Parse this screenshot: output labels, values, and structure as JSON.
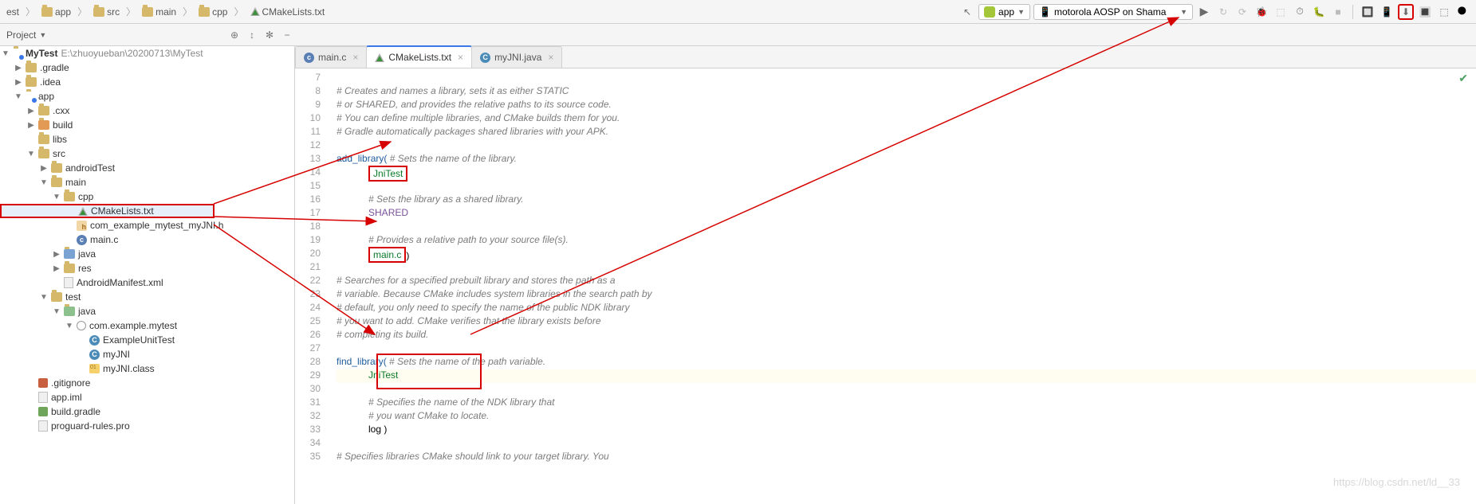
{
  "breadcrumb": {
    "items": [
      {
        "label": "est"
      },
      {
        "label": "app"
      },
      {
        "label": "src"
      },
      {
        "label": "main"
      },
      {
        "label": "cpp"
      },
      {
        "label": "CMakeLists.txt"
      }
    ]
  },
  "runConfig": {
    "app_label": "app",
    "device_label": "motorola AOSP on Shama"
  },
  "projectHeader": {
    "label": "Project"
  },
  "tree": {
    "root_label": "MyTest",
    "root_path": "E:\\zhuoyueban\\20200713\\MyTest",
    "items": {
      "gradle": ".gradle",
      "idea": ".idea",
      "app": "app",
      "cxx": ".cxx",
      "build": "build",
      "libs": "libs",
      "src": "src",
      "androidTest": "androidTest",
      "main": "main",
      "cpp": "cpp",
      "cmake": "CMakeLists.txt",
      "jniHeader": "com_example_mytest_myJNI.h",
      "mainc": "main.c",
      "java": "java",
      "res": "res",
      "manifest": "AndroidManifest.xml",
      "test": "test",
      "java2": "java",
      "pkg": "com.example.mytest",
      "exTest": "ExampleUnitTest",
      "myJni": "myJNI",
      "myJniClass": "myJNI.class",
      "gitignore": ".gitignore",
      "appiml": "app.iml",
      "buildgradle": "build.gradle",
      "proguard": "proguard-rules.pro"
    }
  },
  "tabs": {
    "mainc": "main.c",
    "cmake": "CMakeLists.txt",
    "myjni": "myJNI.java"
  },
  "code": {
    "l8": "# Creates and names a library, sets it as either STATIC",
    "l9": "# or SHARED, and provides the relative paths to its source code.",
    "l10": "# You can define multiple libraries, and CMake builds them for you.",
    "l11": "# Gradle automatically packages shared libraries with your APK.",
    "l13a": "add_library(",
    "l13b": " # Sets the name of the library.",
    "l14": "JniTest",
    "l16": "# Sets the library as a shared library.",
    "l17": "SHARED",
    "l19": "# Provides a relative path to your source file(s).",
    "l20": "main.c",
    "l20b": ")",
    "l22": "# Searches for a specified prebuilt library and stores the path as a",
    "l23": "# variable. Because CMake includes system libraries in the search path by",
    "l24": "# default, you only need to specify the name of the public NDK library",
    "l25": "# you want to add. CMake verifies that the library exists before",
    "l26": "# completing its build.",
    "l28a": "find_library(",
    "l28b": " # Sets the name of the path variable.",
    "l29": "JniTest",
    "l31": "# Specifies the name of the NDK library that",
    "l32": "# you want CMake to locate.",
    "l33": "log )",
    "l35": "# Specifies libraries CMake should link to your target library. You"
  },
  "gutter": {
    "start": 7,
    "end": 35
  },
  "watermark": "https://blog.csdn.net/ld__33"
}
